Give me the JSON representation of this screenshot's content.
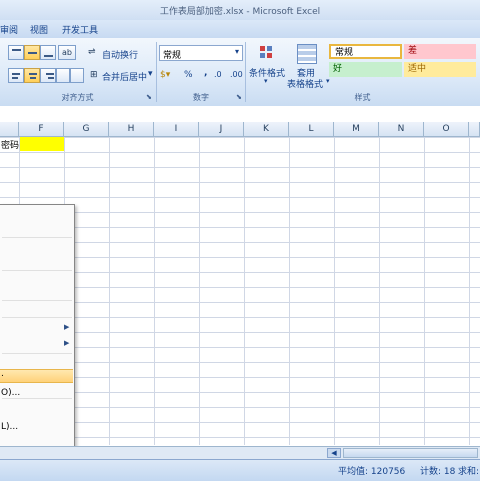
{
  "window": {
    "title": "工作表局部加密.xlsx - Microsoft Excel"
  },
  "tabs": [
    "审阅",
    "视图",
    "开发工具"
  ],
  "ribbon": {
    "alignment": {
      "wrap_text": "自动换行",
      "merge_center": "合并后居中",
      "group_label": "对齐方式"
    },
    "number": {
      "format_value": "常规",
      "percent": "%",
      "comma": ",",
      "group_label": "数字"
    },
    "styles": {
      "conditional_format": "条件格式",
      "table_format_line1": "套用",
      "table_format_line2": "表格格式",
      "cells": [
        {
          "label": "常规",
          "bg": "#ffffff",
          "fg": "#000000"
        },
        {
          "label": "差",
          "bg": "#ffc7ce",
          "fg": "#9c0006"
        },
        {
          "label": "好",
          "bg": "#c6efce",
          "fg": "#006100"
        },
        {
          "label": "适中",
          "bg": "#ffeb9c",
          "fg": "#9c6500"
        }
      ],
      "group_label": "样式"
    }
  },
  "columns": [
    "F",
    "G",
    "H",
    "I",
    "J",
    "K",
    "L",
    "M",
    "N",
    "O"
  ],
  "grid": {
    "e_cell_text": "密码",
    "highlight_color": "#ffff00"
  },
  "context_menu": {
    "items": [
      "",
      "",
      "",
      "",
      "",
      "",
      "",
      "",
      "",
      "",
      "",
      "",
      "",
      "",
      "",
      "",
      "",
      "",
      "",
      "",
      "",
      "",
      "",
      ".",
      "",
      "O)...",
      "",
      "",
      "L)..."
    ]
  },
  "status": {
    "average_label": "平均值: 120756",
    "count_label": "计数: 18",
    "sum_label": "求和:"
  },
  "colors": {
    "accent": "#ffd65a",
    "ribbon": "#dce9f8"
  }
}
